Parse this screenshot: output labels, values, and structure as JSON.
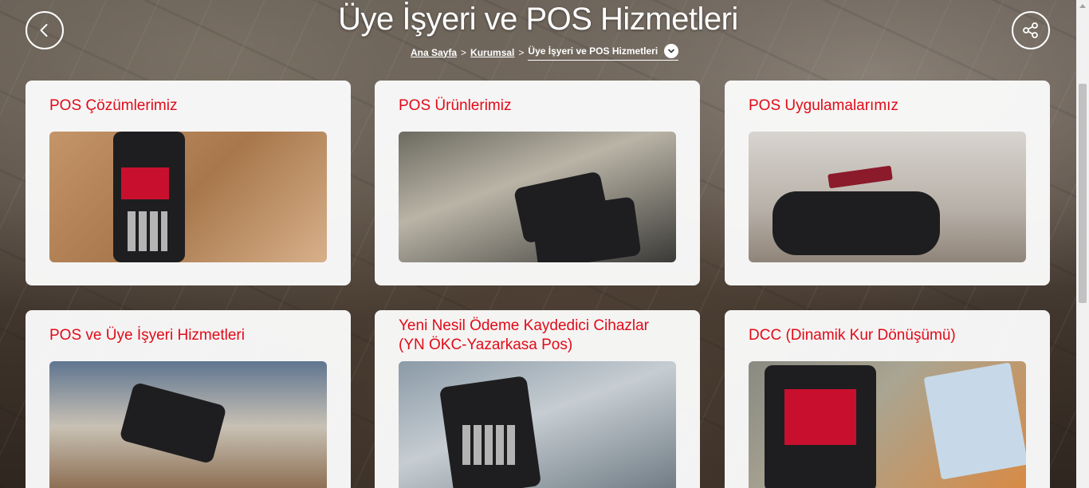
{
  "header": {
    "title": "Üye İşyeri ve POS Hizmetleri",
    "back_icon": "chevron-left-icon",
    "share_icon": "share-icon"
  },
  "breadcrumb": {
    "items": [
      "Ana Sayfa",
      "Kurumsal"
    ],
    "current": "Üye İşyeri ve POS Hizmetleri",
    "separator": ">"
  },
  "cards": [
    {
      "title": "POS Çözümlerimiz",
      "image": "pos-terminal-ziraat"
    },
    {
      "title": "POS Ürünlerimiz",
      "image": "pos-terminals-counter"
    },
    {
      "title": "POS Uygulamalarımız",
      "image": "contactless-card-payment"
    },
    {
      "title": "POS ve Üye İşyeri Hizmetleri",
      "image": "card-handover"
    },
    {
      "title": "Yeni Nesil Ödeme Kaydedici Cihazlar (YN ÖKC-Yazarkasa Pos)",
      "image": "handheld-pos"
    },
    {
      "title": "DCC (Dinamik Kur Dönüşümü)",
      "image": "pos-with-currency"
    }
  ],
  "colors": {
    "accent": "#e30a17",
    "card_bg": "#fafafa",
    "header_text": "#ffffff"
  }
}
